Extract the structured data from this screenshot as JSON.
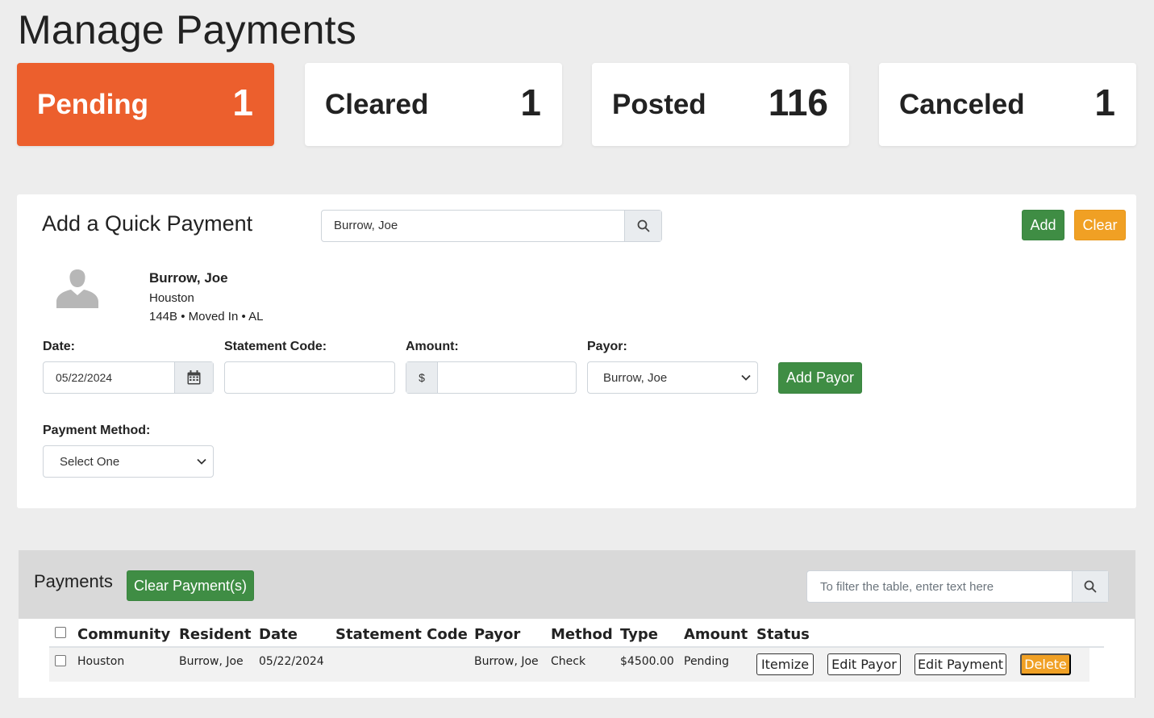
{
  "page": {
    "title": "Manage Payments"
  },
  "stats": [
    {
      "label": "Pending",
      "count": "1"
    },
    {
      "label": "Cleared",
      "count": "1"
    },
    {
      "label": "Posted",
      "count": "116"
    },
    {
      "label": "Canceled",
      "count": "1"
    }
  ],
  "quick_payment": {
    "title": "Add a Quick Payment",
    "search_value": "Burrow, Joe",
    "add_label": "Add",
    "clear_label": "Clear",
    "resident": {
      "name": "Burrow, Joe",
      "community": "Houston",
      "meta": "144B • Moved In • AL"
    },
    "fields": {
      "date_label": "Date:",
      "date_value": "05/22/2024",
      "statement_code_label": "Statement Code:",
      "statement_code_value": "",
      "amount_label": "Amount:",
      "amount_prefix": "$",
      "amount_value": "",
      "payor_label": "Payor:",
      "payor_value": "Burrow, Joe",
      "add_payor_label": "Add Payor",
      "method_label": "Payment Method:",
      "method_value": "Select One"
    }
  },
  "payments": {
    "title": "Payments",
    "clear_payments_label": "Clear Payment(s)",
    "filter_placeholder": "To filter the table, enter text here",
    "columns": [
      "Community",
      "Resident",
      "Date",
      "Statement Code",
      "Payor",
      "Method",
      "Type",
      "Amount",
      "Status"
    ],
    "rows": [
      {
        "community": "Houston",
        "resident": "Burrow, Joe",
        "date": "05/22/2024",
        "statement_code": "",
        "payor": "Burrow, Joe",
        "method": "Check",
        "type": "$4500.00",
        "amount": "Pending",
        "actions": [
          "Itemize",
          "Edit Payor",
          "Edit Payment",
          "Delete"
        ]
      }
    ]
  },
  "colors": {
    "accent_orange": "#ec5f2d",
    "button_green": "#3f8d44",
    "button_amber": "#f0a024"
  }
}
